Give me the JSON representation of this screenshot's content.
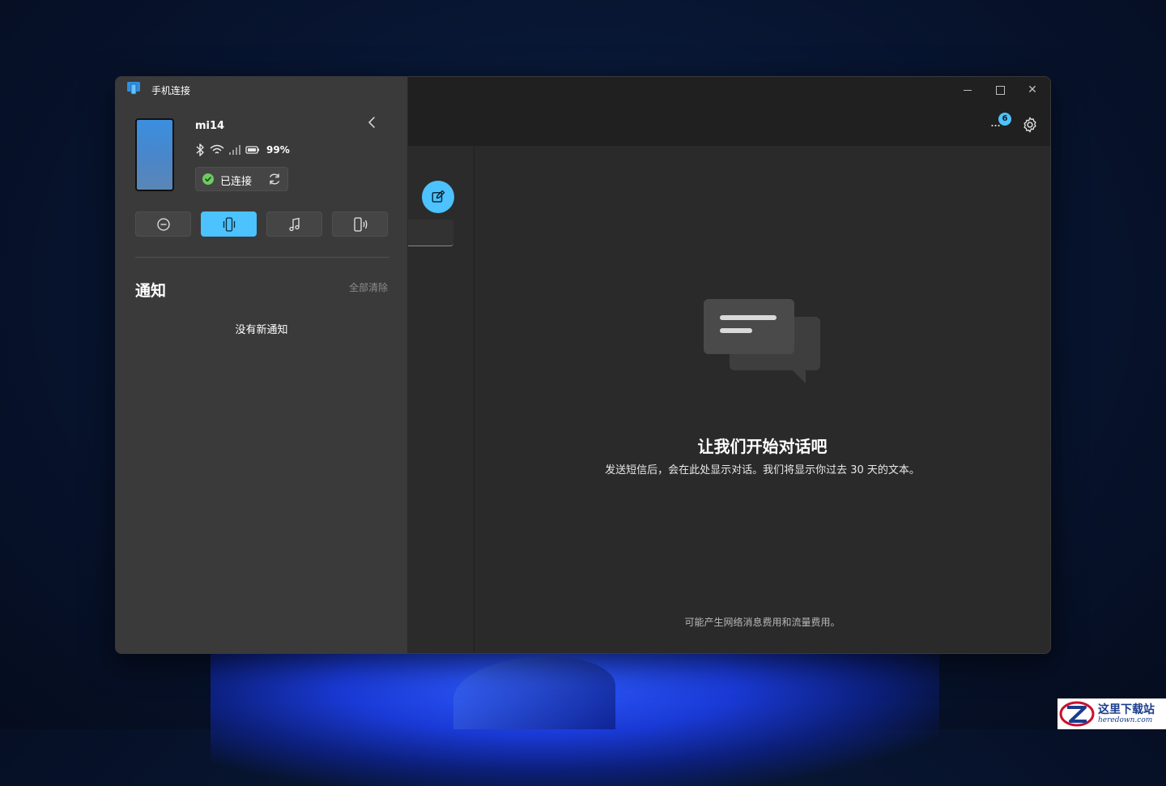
{
  "app": {
    "title": "手机连接"
  },
  "window_controls": {
    "minimize": "minimize-icon",
    "maximize": "maximize-icon",
    "close": "✕"
  },
  "topbar": {
    "more_label": "...",
    "badge_count": "6"
  },
  "device": {
    "name": "mi14",
    "battery": "99%",
    "connection_status": "已连接"
  },
  "quick_actions": [
    {
      "name": "do-not-disturb",
      "icon": "minus-circle-icon",
      "active": false
    },
    {
      "name": "vibrate",
      "icon": "phone-vibrate-icon",
      "active": true
    },
    {
      "name": "media",
      "icon": "music-note-icon",
      "active": false
    },
    {
      "name": "audio-output",
      "icon": "phone-audio-icon",
      "active": false
    }
  ],
  "notifications": {
    "title": "通知",
    "clear_all": "全部清除",
    "empty": "没有新通知"
  },
  "messages": {
    "empty_title": "让我们开始对话吧",
    "empty_desc": "发送短信后，会在此处显示对话。我们将显示你过去 30 天的文本。",
    "footnote": "可能产生网络消息费用和流量费用。"
  },
  "watermark": {
    "cn": "这里下载站",
    "en": "heredown.com"
  },
  "colors": {
    "accent": "#4cc2ff",
    "connected": "#6ccb5f"
  }
}
